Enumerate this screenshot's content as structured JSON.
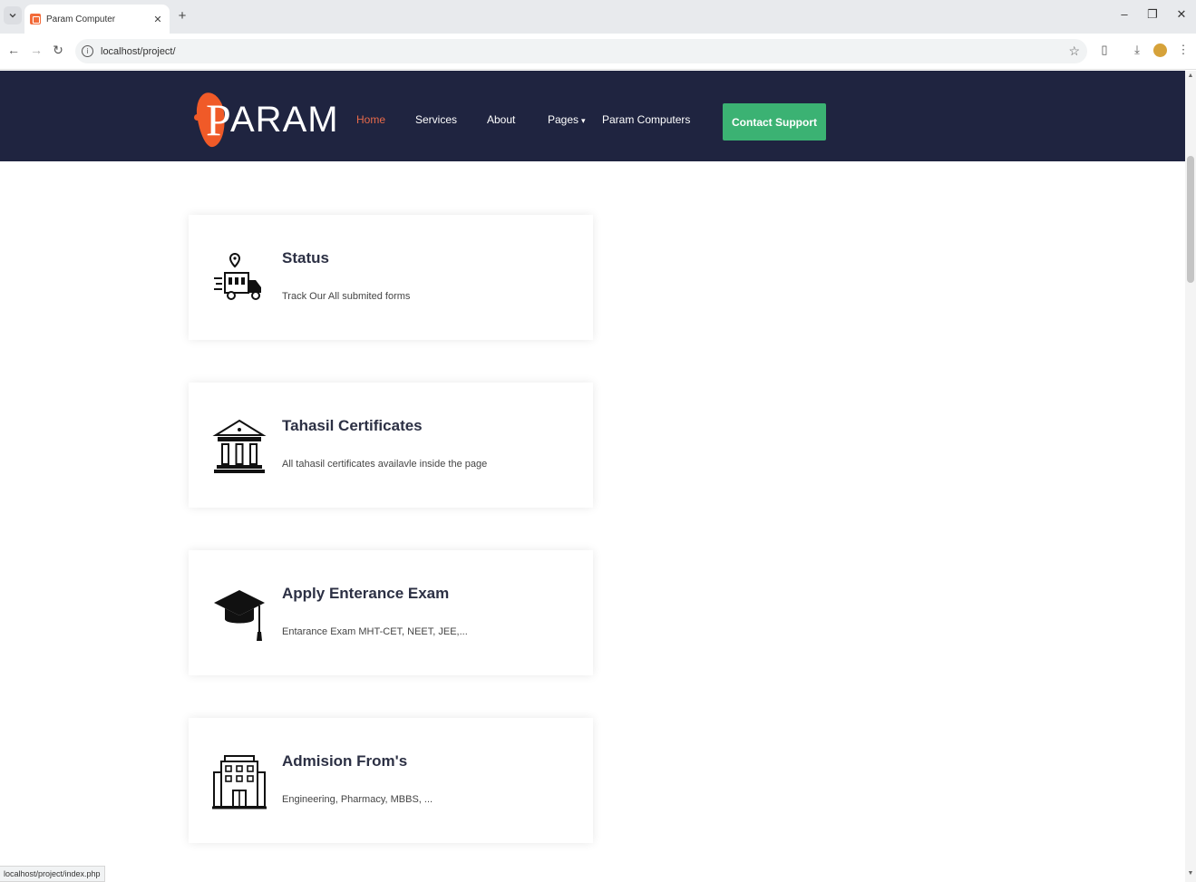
{
  "browser": {
    "tab_title": "Param Computer",
    "url": "localhost/project/",
    "status_url": "localhost/project/index.php"
  },
  "site": {
    "logo_text": "ARAM",
    "logo_initial": "P",
    "brand_color": "#f05a28",
    "header_bg": "#1f2440",
    "nav": [
      {
        "label": "Home",
        "active": true
      },
      {
        "label": "Services"
      },
      {
        "label": "About"
      },
      {
        "label": "Pages"
      },
      {
        "label": "Param Computers"
      }
    ],
    "cta_label": "Contact Support",
    "cta_color": "#3bb273"
  },
  "cards": [
    {
      "icon": "delivery-truck-location-icon",
      "title": "Status",
      "desc": "Track Our All submited forms"
    },
    {
      "icon": "government-building-icon",
      "title": "Tahasil Certificates",
      "desc": "All tahasil certificates availavle inside the page"
    },
    {
      "icon": "graduation-cap-icon",
      "title": "Apply Enterance Exam",
      "desc": "Entarance Exam MHT-CET, NEET, JEE,..."
    },
    {
      "icon": "college-building-icon",
      "title": "Admision From's",
      "desc": "Engineering, Pharmacy, MBBS, ..."
    }
  ]
}
